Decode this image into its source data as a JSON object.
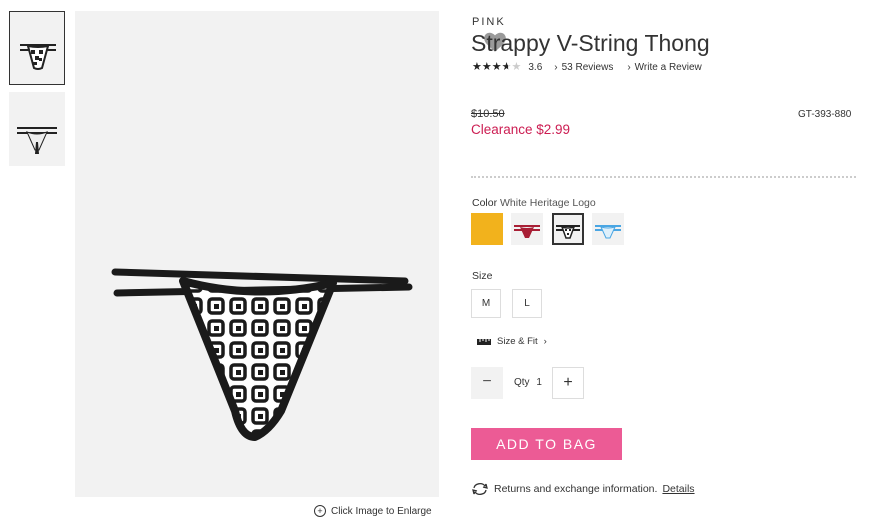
{
  "product": {
    "brand": "PINK",
    "title": "Strappy V-String Thong",
    "rating": 3.6,
    "rating_text": "3.6",
    "reviews_link": "53 Reviews",
    "write_review_link": "Write a Review",
    "original_price": "$10.50",
    "sale_price": "Clearance $2.99",
    "sku": "GT-393-880"
  },
  "color": {
    "label": "Color",
    "selected_value": "White Heritage Logo",
    "swatches": [
      {
        "name": "yellow",
        "color": "#f2b21c"
      },
      {
        "name": "red",
        "color": "#a81f35"
      },
      {
        "name": "white-heritage-logo",
        "color": "#333333"
      },
      {
        "name": "light-blue",
        "color": "#4aa6e3"
      }
    ]
  },
  "size": {
    "label": "Size",
    "options": [
      "M",
      "L"
    ]
  },
  "size_fit_link": "Size & Fit",
  "quantity": {
    "label": "Qty",
    "value": "1",
    "minus": "−",
    "plus": "+"
  },
  "add_to_bag": "ADD TO BAG",
  "returns": {
    "text": "Returns and exchange information.",
    "details_link": "Details"
  },
  "enlarge_text": "Click Image to Enlarge",
  "colors": {
    "accent_pink": "#ec5b95",
    "clearance_red": "#cc1d52",
    "image_bg": "#f2f2f2"
  },
  "icons": [
    "heart-icon",
    "star-icon",
    "chevron-right-icon",
    "ruler-icon",
    "minus-icon",
    "plus-icon",
    "exchange-icon",
    "zoom-icon"
  ]
}
